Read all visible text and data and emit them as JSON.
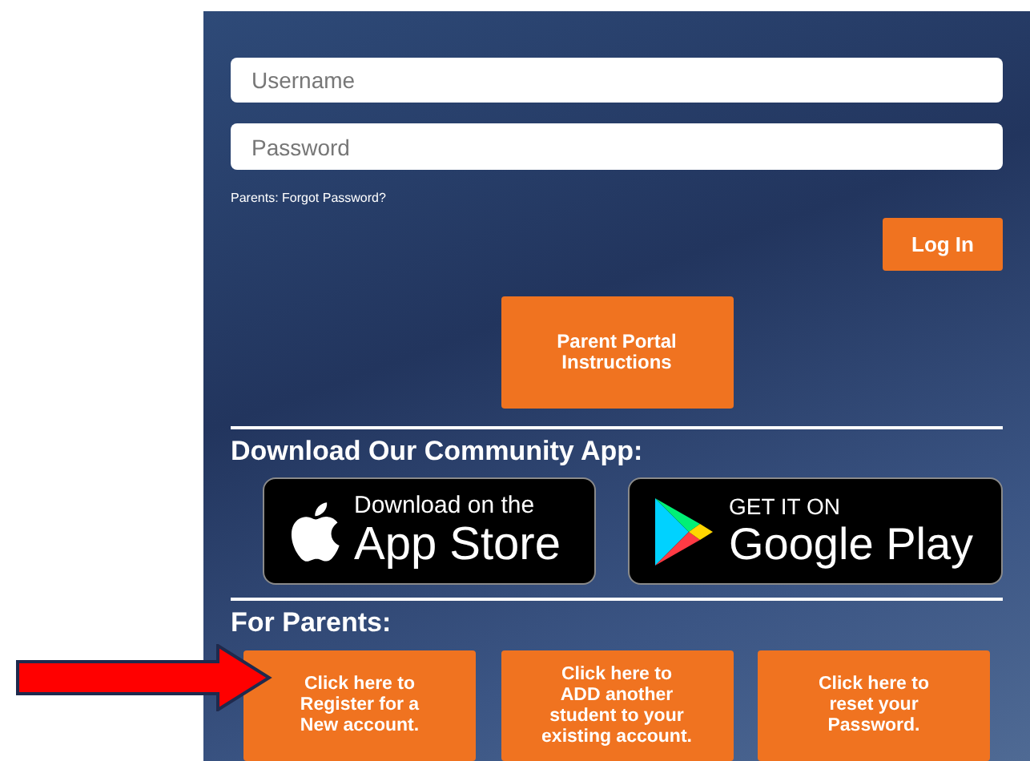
{
  "login": {
    "username": {
      "placeholder": "Username"
    },
    "password": {
      "placeholder": "Password"
    },
    "forgot_link": "Parents: Forgot Password?",
    "login_button": "Log In"
  },
  "instructions_button": [
    "Parent Portal",
    "Instructions"
  ],
  "app_section": {
    "heading": "Download Our Community App:",
    "badges": [
      {
        "kind": "apple",
        "small": "Download on the",
        "large": "App Store"
      },
      {
        "kind": "google",
        "small": "GET IT ON",
        "large": "Google Play"
      }
    ]
  },
  "parents_section": {
    "heading": "For Parents:",
    "buttons": [
      {
        "lines": [
          "Click here to",
          "Register for a",
          "New account."
        ]
      },
      {
        "lines": [
          "Click here to",
          "ADD another",
          "student to your",
          "existing account."
        ]
      },
      {
        "lines": [
          "Click here to",
          "reset your",
          "Password."
        ]
      }
    ]
  }
}
